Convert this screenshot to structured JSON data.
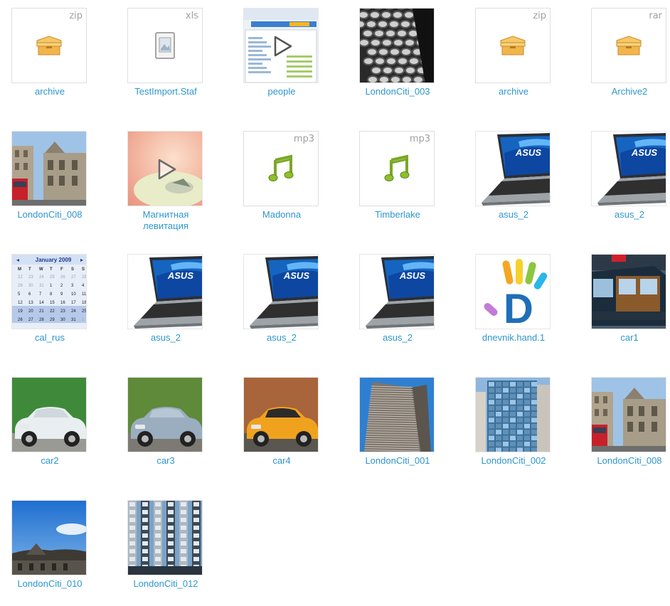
{
  "items": [
    {
      "name": "archive",
      "ext": "zip",
      "kind": "box"
    },
    {
      "name": "TestImport.Staf",
      "ext": "xls",
      "kind": "doc"
    },
    {
      "name": "people",
      "ext": "",
      "kind": "video-people"
    },
    {
      "name": "LondonCiti_003",
      "ext": "",
      "kind": "photo-bw"
    },
    {
      "name": "archive",
      "ext": "zip",
      "kind": "box"
    },
    {
      "name": "Archive2",
      "ext": "rar",
      "kind": "box"
    },
    {
      "name": "LondonCiti_008",
      "ext": "",
      "kind": "photo-street"
    },
    {
      "name": "Магнитная",
      "name2": "левитация",
      "ext": "",
      "kind": "video-levit"
    },
    {
      "name": "Madonna",
      "ext": "mp3",
      "kind": "music"
    },
    {
      "name": "Timberlake",
      "ext": "mp3",
      "kind": "music"
    },
    {
      "name": "asus_2",
      "ext": "",
      "kind": "laptop"
    },
    {
      "name": "asus_2",
      "ext": "",
      "kind": "laptop"
    },
    {
      "name": "cal_rus",
      "ext": "",
      "kind": "calendar",
      "cal_title": "January 2009"
    },
    {
      "name": "asus_2",
      "ext": "",
      "kind": "laptop"
    },
    {
      "name": "asus_2",
      "ext": "",
      "kind": "laptop"
    },
    {
      "name": "asus_2",
      "ext": "",
      "kind": "laptop"
    },
    {
      "name": "dnevnik.hand.1",
      "ext": "",
      "kind": "hand"
    },
    {
      "name": "car1",
      "ext": "",
      "kind": "car-wood"
    },
    {
      "name": "car2",
      "ext": "",
      "kind": "car-white"
    },
    {
      "name": "car3",
      "ext": "",
      "kind": "car-grey"
    },
    {
      "name": "car4",
      "ext": "",
      "kind": "car-orange"
    },
    {
      "name": "LondonCiti_001",
      "ext": "",
      "kind": "photo-tower"
    },
    {
      "name": "LondonCiti_002",
      "ext": "",
      "kind": "photo-glass"
    },
    {
      "name": "LondonCiti_008",
      "ext": "",
      "kind": "photo-street"
    },
    {
      "name": "LondonCiti_010",
      "ext": "",
      "kind": "photo-sky"
    },
    {
      "name": "LondonCiti_012",
      "ext": "",
      "kind": "photo-lloyds"
    }
  ],
  "laptop_brand": "ASUS",
  "hand_letter": "D",
  "colors": {
    "label": "#2d96cc",
    "ext": "#a0a0a0",
    "box": "#f2b54a",
    "note": "#7aa823"
  }
}
